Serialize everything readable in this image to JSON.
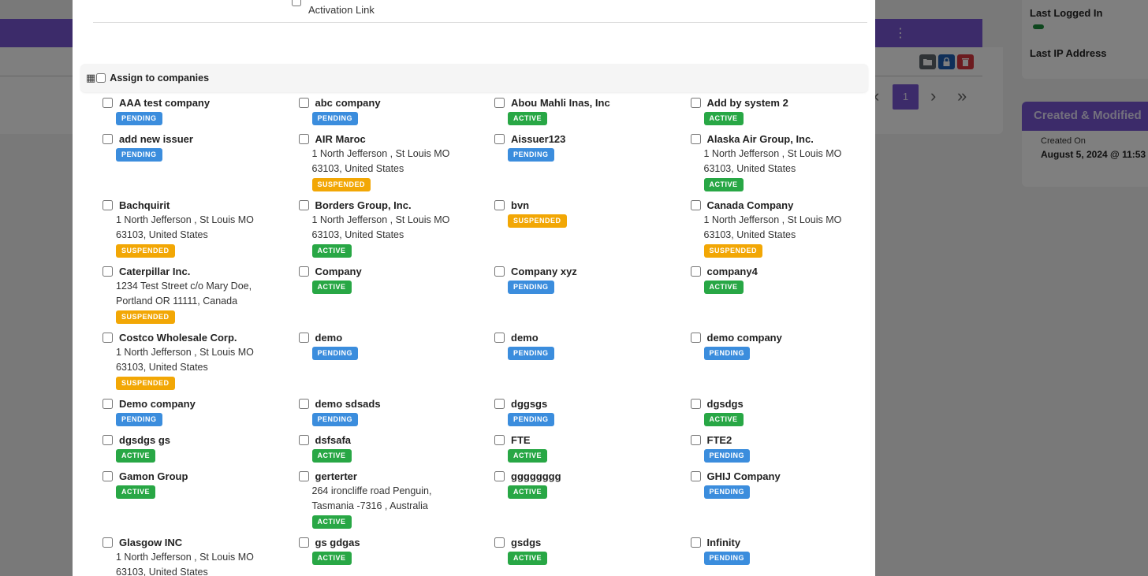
{
  "background": {
    "more_icon": "vertical-ellipsis-icon",
    "pager": {
      "current_page": "1"
    },
    "last_logged_in_label": "Last Logged In",
    "last_ip_label": "Last IP Address",
    "created_modified": {
      "title": "Created & Modified",
      "created_on_label": "Created On",
      "created_on_value": "August 5, 2024 @ 11:53"
    }
  },
  "modal": {
    "activation_link_label": "Activation Link",
    "assign_label": "Assign to companies",
    "status_colors": {
      "PENDING": "#3b8ddd",
      "ACTIVE": "#28a745",
      "SUSPENDED": "#f2a705"
    },
    "companies": [
      {
        "name": "AAA test company",
        "address": [],
        "status": "PENDING"
      },
      {
        "name": "abc company",
        "address": [],
        "status": "PENDING"
      },
      {
        "name": "Abou Mahli Inas, Inc",
        "address": [],
        "status": "ACTIVE"
      },
      {
        "name": "Add by system 2",
        "address": [],
        "status": "ACTIVE"
      },
      {
        "name": "add new issuer",
        "address": [],
        "status": "PENDING"
      },
      {
        "name": "AIR Maroc",
        "address": [
          "1 North Jefferson , St Louis MO",
          "63103, United States"
        ],
        "status": "SUSPENDED"
      },
      {
        "name": "Aissuer123",
        "address": [],
        "status": "PENDING"
      },
      {
        "name": "Alaska Air Group, Inc.",
        "address": [
          "1 North Jefferson , St Louis MO",
          "63103, United States"
        ],
        "status": "ACTIVE"
      },
      {
        "name": "Bachquirit",
        "address": [
          "1 North Jefferson , St Louis MO",
          "63103, United States"
        ],
        "status": "SUSPENDED"
      },
      {
        "name": "Borders Group, Inc.",
        "address": [
          "1 North Jefferson , St Louis MO",
          "63103, United States"
        ],
        "status": "ACTIVE"
      },
      {
        "name": "bvn",
        "address": [],
        "status": "SUSPENDED"
      },
      {
        "name": "Canada Company",
        "address": [
          "1 North Jefferson , St Louis MO",
          "63103, United States"
        ],
        "status": "SUSPENDED"
      },
      {
        "name": "Caterpillar Inc.",
        "address": [
          "1234 Test Street c/o Mary Doe,",
          "Portland OR 11111, Canada"
        ],
        "status": "SUSPENDED"
      },
      {
        "name": "Company",
        "address": [],
        "status": "ACTIVE"
      },
      {
        "name": "Company xyz",
        "address": [],
        "status": "PENDING"
      },
      {
        "name": "company4",
        "address": [],
        "status": "ACTIVE"
      },
      {
        "name": "Costco Wholesale Corp.",
        "address": [
          "1 North Jefferson , St Louis MO",
          "63103, United States"
        ],
        "status": "SUSPENDED"
      },
      {
        "name": "demo",
        "address": [],
        "status": "PENDING"
      },
      {
        "name": "demo",
        "address": [],
        "status": "PENDING"
      },
      {
        "name": "demo company",
        "address": [],
        "status": "PENDING"
      },
      {
        "name": "Demo company",
        "address": [],
        "status": "PENDING"
      },
      {
        "name": "demo sdsads",
        "address": [],
        "status": "PENDING"
      },
      {
        "name": "dggsgs",
        "address": [],
        "status": "PENDING"
      },
      {
        "name": "dgsdgs",
        "address": [],
        "status": "ACTIVE"
      },
      {
        "name": "dgsdgs gs",
        "address": [],
        "status": "ACTIVE"
      },
      {
        "name": "dsfsafa",
        "address": [],
        "status": "ACTIVE"
      },
      {
        "name": "FTE",
        "address": [],
        "status": "ACTIVE"
      },
      {
        "name": "FTE2",
        "address": [],
        "status": "PENDING"
      },
      {
        "name": "Gamon Group",
        "address": [],
        "status": "ACTIVE"
      },
      {
        "name": "gerterter",
        "address": [
          "264 ironcliffe road Penguin,",
          "Tasmania -7316 , Australia"
        ],
        "status": "ACTIVE"
      },
      {
        "name": "gggggggg",
        "address": [],
        "status": "ACTIVE"
      },
      {
        "name": "GHIJ Company",
        "address": [],
        "status": "PENDING"
      },
      {
        "name": "Glasgow INC",
        "address": [
          "1 North Jefferson , St Louis MO",
          "63103, United States"
        ],
        "status": ""
      },
      {
        "name": "gs gdgas",
        "address": [],
        "status": "ACTIVE"
      },
      {
        "name": "gsdgs",
        "address": [],
        "status": "ACTIVE"
      },
      {
        "name": "Infinity",
        "address": [],
        "status": "PENDING"
      }
    ]
  }
}
